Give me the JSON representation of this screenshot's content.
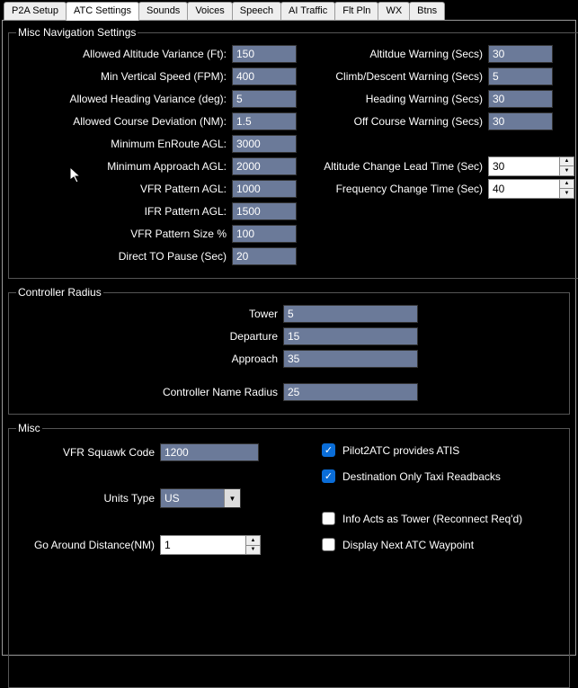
{
  "tabs": [
    "P2A Setup",
    "ATC Settings",
    "Sounds",
    "Voices",
    "Speech",
    "AI Traffic",
    "Flt Pln",
    "WX",
    "Btns"
  ],
  "activeTab": 1,
  "nav": {
    "legend": "Misc Navigation Settings",
    "left": {
      "altVarLbl": "Allowed Altitude Variance (Ft):",
      "altVar": "150",
      "minVsLbl": "Min Vertical Speed (FPM):",
      "minVs": "400",
      "hdgVarLbl": "Allowed Heading Variance (deg):",
      "hdgVar": "5",
      "crsDevLbl": "Allowed Course Deviation (NM):",
      "crsDev": "1.5",
      "minEnrLbl": "Minimum EnRoute AGL:",
      "minEnr": "3000",
      "minAppLbl": "Minimum Approach AGL:",
      "minApp": "2000",
      "vfrPatLbl": "VFR Pattern AGL:",
      "vfrPat": "1000",
      "ifrPatLbl": "IFR Pattern AGL:",
      "ifrPat": "1500",
      "vfrSizeLbl": "VFR Pattern Size %",
      "vfrSize": "100",
      "dtoPauseLbl": "Direct TO Pause (Sec)",
      "dtoPause": "20"
    },
    "right": {
      "altWarnLbl": "Altitdue Warning (Secs)",
      "altWarn": "30",
      "cdWarnLbl": "Climb/Descent Warning (Secs)",
      "cdWarn": "5",
      "hdgWarnLbl": "Heading Warning (Secs)",
      "hdgWarn": "30",
      "ocWarnLbl": "Off Course Warning (Secs)",
      "ocWarn": "30",
      "altLeadLbl": "Altitude Change Lead Time (Sec)",
      "altLead": "30",
      "freqLbl": "Frequency Change Time (Sec)",
      "freq": "40"
    }
  },
  "ctrl": {
    "legend": "Controller Radius",
    "towerLbl": "Tower",
    "tower": "5",
    "depLbl": "Departure",
    "dep": "15",
    "appLbl": "Approach",
    "app": "35",
    "nameLbl": "Controller Name Radius",
    "name": "25"
  },
  "misc": {
    "legend": "Misc",
    "squawkLbl": "VFR Squawk Code",
    "squawk": "1200",
    "unitsLbl": "Units Type",
    "units": "US",
    "gaLbl": "Go Around Distance(NM)",
    "ga": "1",
    "atisLbl": "Pilot2ATC provides ATIS",
    "destTaxiLbl": "Destination Only Taxi Readbacks",
    "infoTowerLbl": "Info Acts as Tower (Reconnect Req'd)",
    "nextWpLbl": "Display Next ATC Waypoint"
  }
}
